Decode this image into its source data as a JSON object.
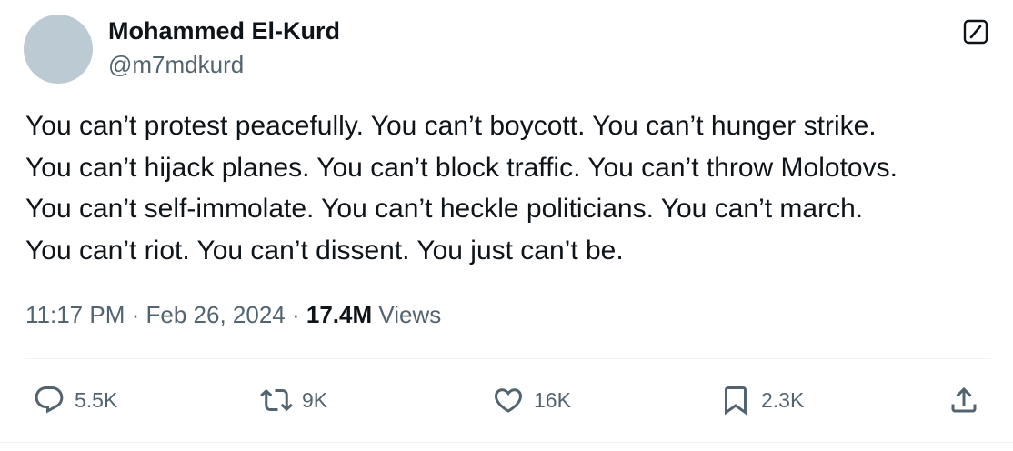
{
  "author": {
    "display_name": "Mohammed El-Kurd",
    "handle": "@m7mdkurd"
  },
  "tweet": {
    "lines": [
      "You can’t protest peacefully. You can’t boycott. You can’t hunger strike.",
      "You can’t hijack planes. You can’t block traffic. You can’t throw Molotovs.",
      "You can’t self-immolate. You can’t heckle politicians. You can’t march.",
      "You can’t riot. You can’t dissent. You just can’t be."
    ]
  },
  "meta": {
    "time": "11:17 PM",
    "separator": "·",
    "date": "Feb 26, 2024",
    "views_count": "17.4M",
    "views_label": "Views"
  },
  "actions": {
    "replies": "5.5K",
    "reposts": "9K",
    "likes": "16K",
    "bookmarks": "2.3K"
  },
  "icons": {
    "grok": "grok-icon",
    "reply": "reply-icon",
    "repost": "repost-icon",
    "like": "like-icon",
    "bookmark": "bookmark-icon",
    "share": "share-icon"
  },
  "colors": {
    "text_primary": "#0f1419",
    "text_secondary": "#536471",
    "avatar_placeholder": "#bccad4",
    "divider": "#eff3f4"
  }
}
